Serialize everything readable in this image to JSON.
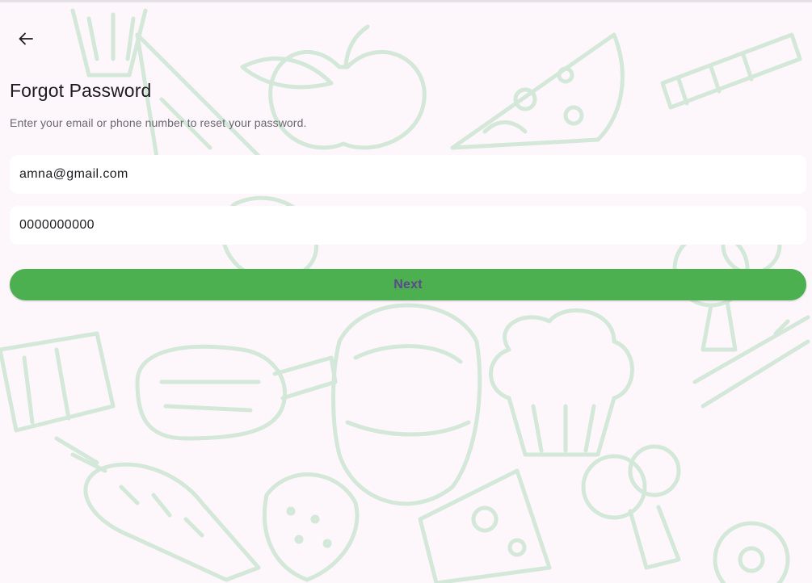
{
  "header": {
    "back_icon": "arrow-left-icon"
  },
  "page": {
    "title": "Forgot Password",
    "subtitle": "Enter your email or phone number to reset your password."
  },
  "form": {
    "email_value": "amna@gmail.com",
    "phone_value": "0000000000",
    "next_label": "Next"
  },
  "colors": {
    "background": "#fdf6fb",
    "pattern_stroke": "#cfe7d6",
    "button": "#4caf50",
    "button_text": "#5a4a8a",
    "field": "#ffffff"
  },
  "background": {
    "pattern": "food-doodle-pattern"
  }
}
